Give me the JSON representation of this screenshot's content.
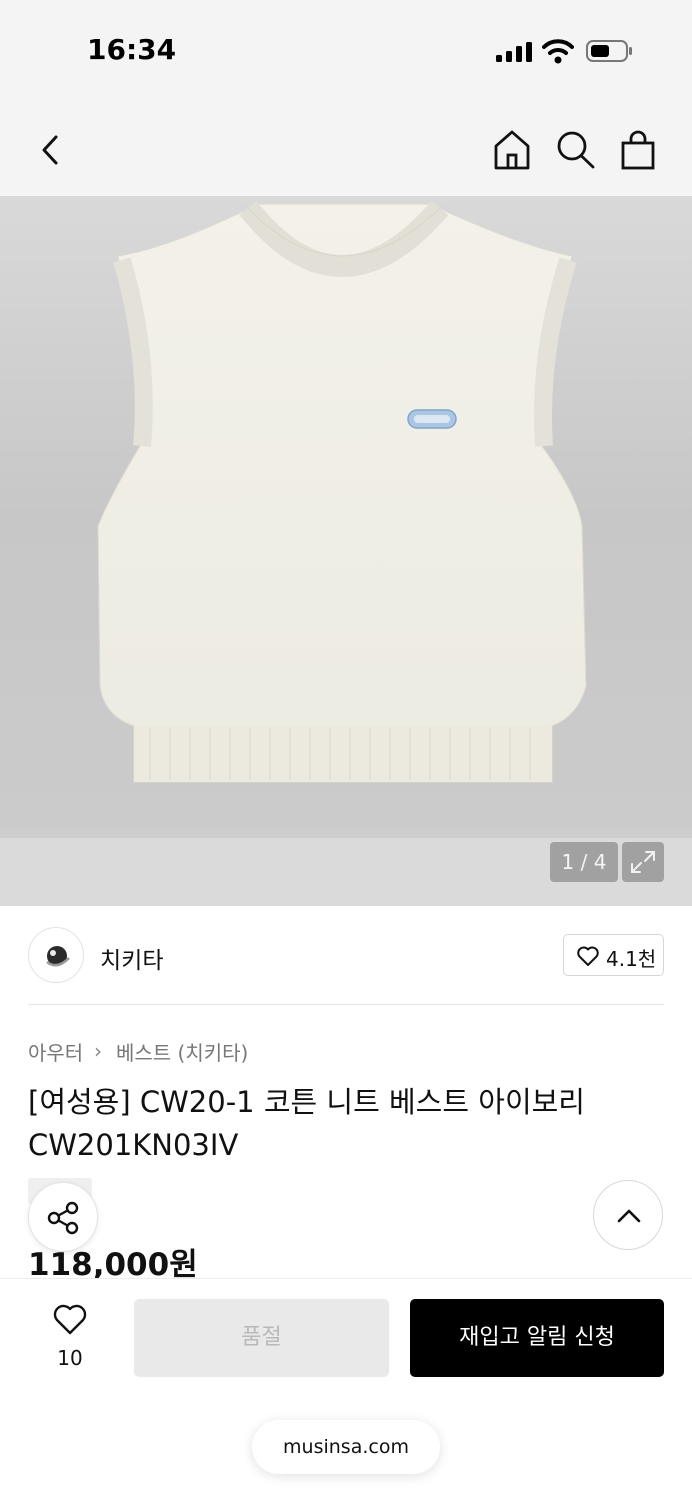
{
  "status": {
    "time": "16:34"
  },
  "gallery": {
    "pager": "1 / 4"
  },
  "brand": {
    "name": "치키타",
    "likes": "4.1천"
  },
  "category": {
    "level1": "아우터",
    "separator": "›",
    "level2": "베스트 (치키타)"
  },
  "product": {
    "title": "[여성용] CW20-1 코튼 니트 베스트 아이보리 CW201KN03IV",
    "price": "118,000원"
  },
  "actions": {
    "wish_count": "10",
    "soldout_label": "품절",
    "restock_label": "재입고 알림 신청"
  },
  "browser": {
    "url": "musinsa.com"
  },
  "colors": {
    "accent": "#000000",
    "disabled_bg": "#e9e9e9",
    "disabled_text": "#b9b9b9",
    "chrome_bg": "#f4f4f4"
  },
  "icons": [
    "back-icon",
    "home-icon",
    "search-icon",
    "bag-icon",
    "expand-icon",
    "heart-icon",
    "share-icon",
    "chevron-up-icon"
  ]
}
